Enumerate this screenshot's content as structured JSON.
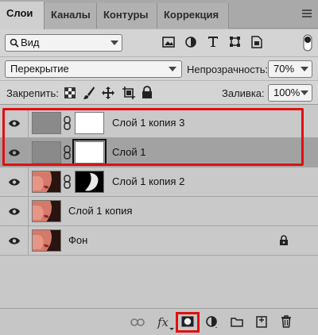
{
  "tabs": [
    {
      "label": "Слои"
    },
    {
      "label": "Каналы"
    },
    {
      "label": "Контуры"
    },
    {
      "label": "Коррекция"
    }
  ],
  "filter": {
    "label": "Вид"
  },
  "blend": {
    "mode": "Перекрытие",
    "opacity_label": "Непрозрачность:",
    "opacity_value": "70%"
  },
  "lock": {
    "label": "Закрепить:",
    "fill_label": "Заливка:",
    "fill_value": "100%"
  },
  "layers": [
    {
      "name": "Слой 1 копия 3",
      "selected": false
    },
    {
      "name": "Слой 1",
      "selected": true
    },
    {
      "name": "Слой 1 копия 2",
      "selected": false
    },
    {
      "name": "Слой 1 копия",
      "selected": false
    },
    {
      "name": "Фон",
      "selected": false
    }
  ],
  "bottom": {
    "fx_label": "fx"
  },
  "colors": {
    "highlight": "#e01010",
    "selected_row": "#a2a2a2"
  }
}
